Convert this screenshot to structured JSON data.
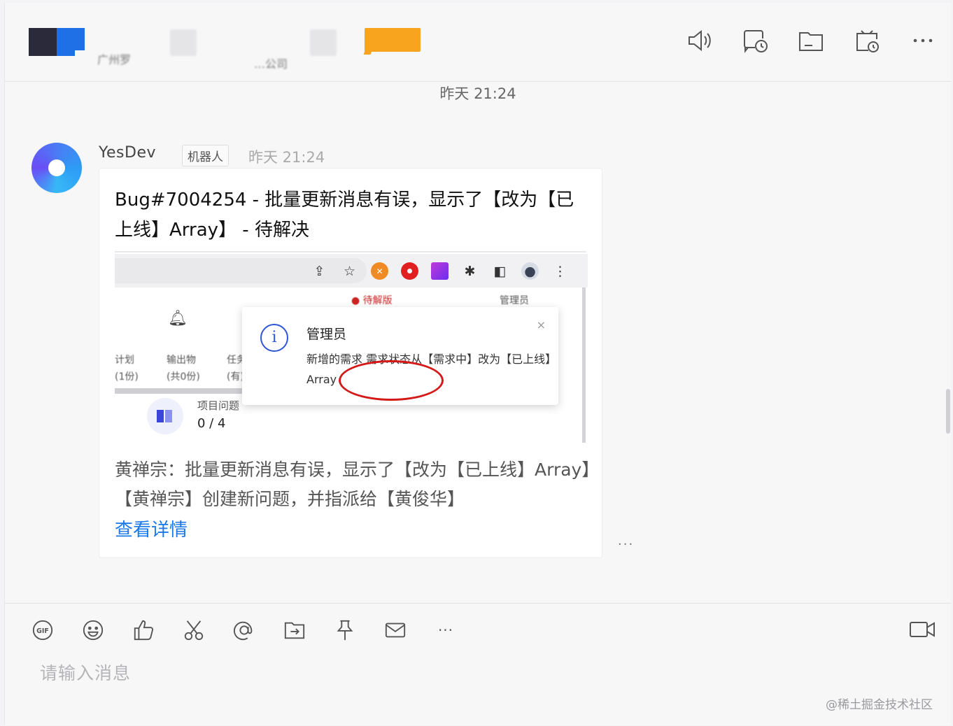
{
  "header": {
    "blurred_name_1": "广州罗",
    "blurred_name_2": "…公司",
    "icons": [
      "speaker-icon",
      "chat-history-icon",
      "folder-icon",
      "calendar-clock-icon",
      "more-icon"
    ]
  },
  "chat": {
    "time_separator": "昨天 21:24",
    "message": {
      "sender": "YesDev",
      "badge": "机器人",
      "time": "昨天 21:24",
      "title": "Bug#7004254 - 批量更新消息有误，显示了【改为【已上线】Array】 - 待解决",
      "body": "黄禅宗：批量更新消息有误，显示了【改为【已上线】Array】【黄禅宗】创建新问题，并指派给【黄俊华】",
      "link": "查看详情",
      "more": "···"
    },
    "embedded": {
      "col1": "计划\n(1份)",
      "col2": "输出物\n(共0份)",
      "col3": "任务\n(有)",
      "partial_top_left": "● 待解版",
      "partial_top_right": "管理员",
      "project_label": "项目问题",
      "project_count": "0 / 4",
      "notification": {
        "title": "管理员",
        "close": "×",
        "body": "新增的需求 需求状态从【需求中】改为【已上线】Array"
      }
    }
  },
  "composer": {
    "placeholder": "请输入消息",
    "more": "···",
    "tools": [
      "gif-icon",
      "emoji-icon",
      "thumbs-up-icon",
      "scissors-icon",
      "at-icon",
      "forward-icon",
      "pin-icon",
      "mail-icon",
      "more-icon",
      "video-icon"
    ]
  },
  "watermark": "@稀土掘金技术社区"
}
